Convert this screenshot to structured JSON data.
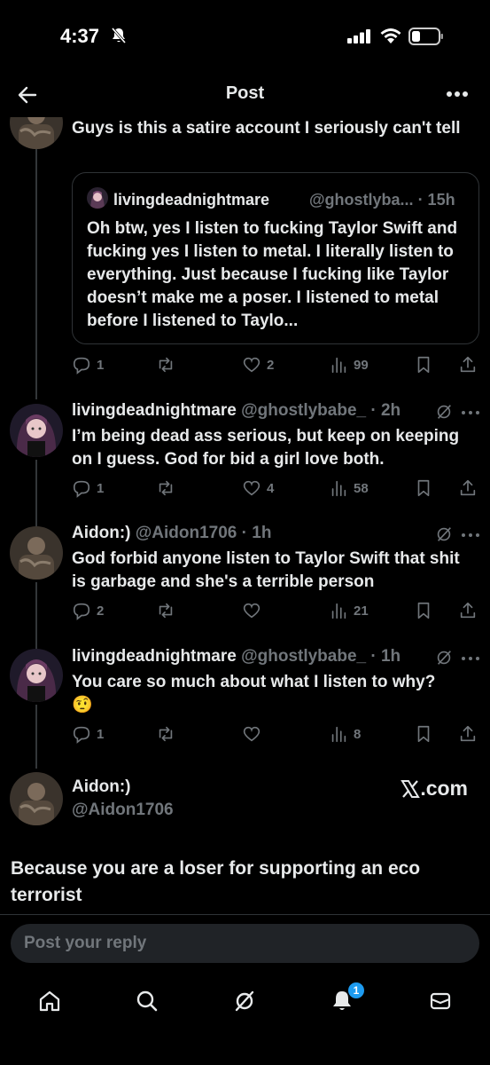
{
  "status_bar": {
    "time": "4:37"
  },
  "header": {
    "title": "Post"
  },
  "quoted_reply": {
    "text": "Guys is this a satire account I seriously can't tell",
    "quote": {
      "name": "livingdeadnightmare",
      "handle_time": "@ghostlyba... · 15h",
      "text": "Oh btw, yes I listen to fucking Taylor Swift and fucking yes I listen to metal. I literally listen to everything. Just because I fucking like Taylor doesn’t make me a poser. I listened to metal before I listened to Taylo..."
    },
    "actions": {
      "replies": "1",
      "likes": "2",
      "views": "99"
    }
  },
  "replies": [
    {
      "name": "livingdeadnightmare",
      "handle": "@ghostlybabe_",
      "time": "· 2h",
      "text": "I’m being dead ass serious, but keep on keeping on I guess. God for bid a girl love both.",
      "actions": {
        "replies": "1",
        "likes": "4",
        "views": "58"
      }
    },
    {
      "name": "Aidon:)",
      "handle": "@Aidon1706",
      "time": "· 1h",
      "text": "God forbid anyone listen to Taylor Swift that shit is garbage and she's a terrible person",
      "actions": {
        "replies": "2",
        "likes": "",
        "views": "21"
      }
    },
    {
      "name": "livingdeadnightmare",
      "handle": "@ghostlybabe_",
      "time": "· 1h",
      "text": "You care so much about what I listen to why?",
      "emoji": "🤨",
      "actions": {
        "replies": "1",
        "likes": "",
        "views": "8"
      }
    }
  ],
  "main_post": {
    "name": "Aidon:)",
    "handle": "@Aidon1706",
    "source": ".com",
    "text": "Because you are a loser for supporting an eco terrorist"
  },
  "reply_input": {
    "placeholder": "Post your reply"
  },
  "tab_bar": {
    "notification_badge": "1"
  },
  "colors": {
    "background": "#000000",
    "text": "#e7e9ea",
    "muted": "#71767b",
    "accent": "#1d9bf0"
  }
}
